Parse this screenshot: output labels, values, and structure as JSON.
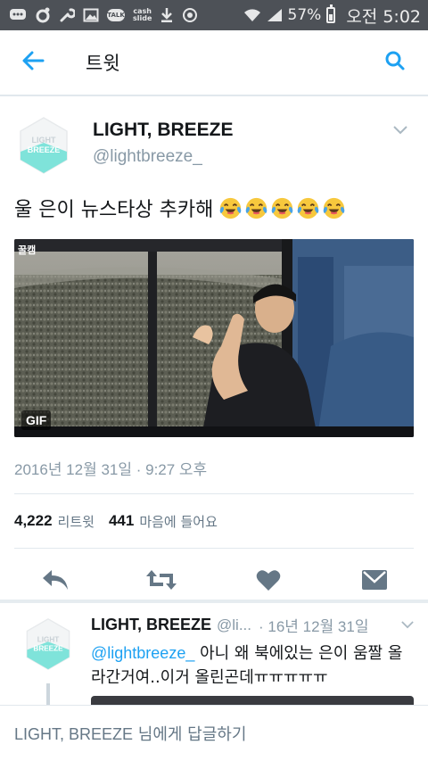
{
  "status_bar": {
    "talk_label": "TALK",
    "cash_label_1": "cash",
    "cash_label_2": "slide",
    "battery_text": "57%",
    "battery_level": 0.57,
    "clock": "오전 5:02"
  },
  "app_bar": {
    "title": "트윗",
    "accent": "#1da1f2"
  },
  "tweet": {
    "display_name": "LIGHT, BREEZE",
    "handle": "@lightbreeze_",
    "text": "울 은이 뉴스타상 추카해",
    "emoji_icon": "crying-laughing-emoji",
    "emoji_count": 5,
    "media": {
      "watermark": "꿀캠",
      "badge": "GIF"
    },
    "timestamp": "2016년 12월 31일 · 9:27 오후",
    "retweets_count": "4,222",
    "retweets_label": "리트윗",
    "likes_count": "441",
    "likes_label": "마음에 들어요",
    "avatar_text_1": "LIGHT",
    "avatar_text_2": "BREEZE"
  },
  "actions": [
    "reply-icon",
    "retweet-icon",
    "heart-icon",
    "direct-message-icon"
  ],
  "reply": {
    "display_name": "LIGHT, BREEZE",
    "handle": "@li...",
    "time": "· 16년 12월 31일",
    "mention": "@lightbreeze_",
    "text_rest": " 아니 왜 북에있는 은이 움짤 올라간거여..이거 올린곤데ㅠㅠㅠㅠㅠ"
  },
  "composer": {
    "name": "LIGHT, BREEZE",
    "suffix": " 님에게 답글하기"
  },
  "colors": {
    "accent": "#1da1f2",
    "status_bar": "#4d5157",
    "secondary_text": "#8899a6",
    "avatar_mint": "#7fe3da"
  }
}
